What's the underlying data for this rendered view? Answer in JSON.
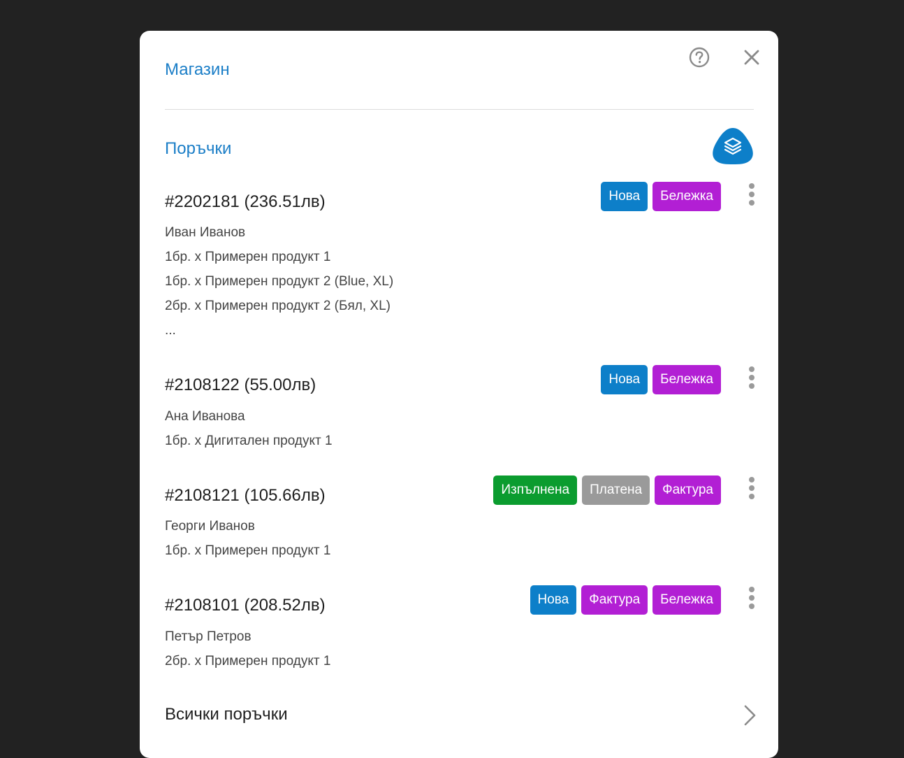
{
  "header": {
    "title": "Магазин",
    "help_icon": "help-circle-icon",
    "close_icon": "close-icon"
  },
  "section": {
    "title": "Поръчки",
    "layers_icon": "layers-icon"
  },
  "colors": {
    "accent": "#1b7ec7",
    "badge_blue": "#0d7fc9",
    "badge_purple": "#b21fd4",
    "badge_green": "#0b9c2f",
    "badge_gray": "#9a9a9a"
  },
  "orders": [
    {
      "title": "#2202181 (236.51лв)",
      "customer": "Иван Иванов",
      "items": [
        "1бр. x Примерен продукт 1",
        "1бр. x Примерен продукт 2 (Blue, XL)",
        "2бр. x Примерен продукт 2 (Бял, XL)",
        "..."
      ],
      "badges": [
        {
          "label": "Нова",
          "color": "blue"
        },
        {
          "label": "Бележка",
          "color": "purple"
        }
      ]
    },
    {
      "title": "#2108122 (55.00лв)",
      "customer": "Ана Иванова",
      "items": [
        "1бр. x Дигитален продукт 1"
      ],
      "badges": [
        {
          "label": "Нова",
          "color": "blue"
        },
        {
          "label": "Бележка",
          "color": "purple"
        }
      ]
    },
    {
      "title": "#2108121 (105.66лв)",
      "customer": "Георги Иванов",
      "items": [
        "1бр. x Примерен продукт 1"
      ],
      "badges": [
        {
          "label": "Изпълнена",
          "color": "green"
        },
        {
          "label": "Платена",
          "color": "gray"
        },
        {
          "label": "Фактура",
          "color": "purple"
        }
      ]
    },
    {
      "title": "#2108101 (208.52лв)",
      "customer": "Петър Петров",
      "items": [
        "2бр. x Примерен продукт 1"
      ],
      "badges": [
        {
          "label": "Нова",
          "color": "blue"
        },
        {
          "label": "Фактура",
          "color": "purple"
        },
        {
          "label": "Бележка",
          "color": "purple"
        }
      ]
    }
  ],
  "footer": {
    "all_orders_label": "Всички поръчки",
    "chevron_icon": "chevron-right-icon"
  }
}
